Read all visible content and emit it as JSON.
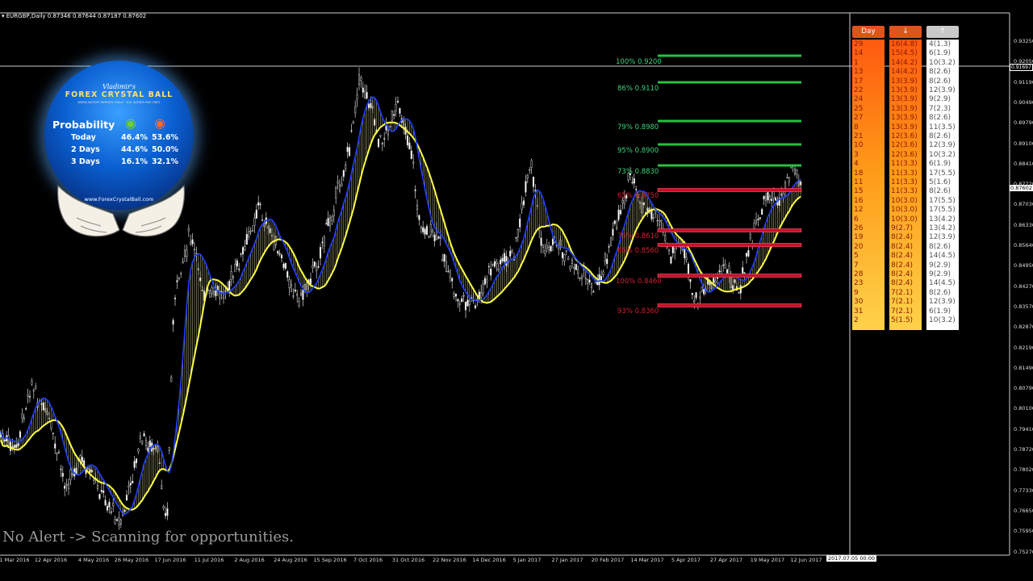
{
  "symbol_line": "EURGBP,Daily  0.87346 0.87644 0.87187 0.87602",
  "alert_text": "No Alert -> Scanning for opportunities.",
  "y_axis": [
    "0.93250",
    "0.92050",
    "0.91190",
    "0.90490",
    "0.89790",
    "0.89100",
    "0.88410",
    "0.87720",
    "0.87030",
    "0.86330",
    "0.85640",
    "0.84950",
    "0.84270",
    "0.83570",
    "0.82870",
    "0.82190",
    "0.81490",
    "0.80790",
    "0.80100",
    "0.79410",
    "0.78720",
    "0.78020",
    "0.77330",
    "0.76650",
    "0.75950",
    "0.75270"
  ],
  "price_tag": "0.87602",
  "cursor_price_tag": "0.91697",
  "x_axis": [
    "1 Mar 2016",
    "12 Apr 2016",
    "4 May 2016",
    "26 May 2016",
    "17 Jun 2016",
    "11 Jul 2016",
    "2 Aug 2016",
    "24 Aug 2016",
    "15 Sep 2016",
    "7 Oct 2016",
    "31 Oct 2016",
    "22 Nov 2016",
    "14 Dec 2016",
    "5 Jan 2017",
    "27 Jan 2017",
    "20 Feb 2017",
    "14 Mar 2017",
    "5 Apr 2017",
    "27 Apr 2017",
    "19 May 2017",
    "12 Jun 2017"
  ],
  "date_tag": "2017.07.05 00:00",
  "levels": [
    {
      "label": "100% 0.9200",
      "color": "green"
    },
    {
      "label": "86% 0.9110",
      "color": "green"
    },
    {
      "label": "79% 0.8980",
      "color": "green"
    },
    {
      "label": "95% 0.8900",
      "color": "green"
    },
    {
      "label": "73% 0.8830",
      "color": "green"
    },
    {
      "label": "65% 0.8750",
      "color": "red"
    },
    {
      "label": "75% 0.8610",
      "color": "red"
    },
    {
      "label": "66% 0.8560",
      "color": "red"
    },
    {
      "label": "100% 0.8460",
      "color": "red"
    },
    {
      "label": "93% 0.8360",
      "color": "red"
    }
  ],
  "logo": {
    "title1": "Vladimir's",
    "title2": "FOREX CRYSTAL BALL",
    "subtitle": "WHEN HISTORY REPEATS ITSELF · YOU GATHER FIVE FIRST",
    "prob_label": "Probability",
    "rows": [
      {
        "label": "Today",
        "bull": "46.4%",
        "bear": "53.6%"
      },
      {
        "label": "2 Days",
        "bull": "44.6%",
        "bear": "50.0%"
      },
      {
        "label": "3 Days",
        "bull": "16.1%",
        "bear": "32.1%"
      }
    ],
    "url": "www.ForexCrystalBall.com"
  },
  "table": {
    "headers": {
      "day": "Day",
      "down": "↓",
      "up": "↑"
    },
    "rows": [
      [
        "29",
        "16(4.8)",
        "4(1.3)"
      ],
      [
        "14",
        "15(4.5)",
        "6(1.9)"
      ],
      [
        "1",
        "14(4.2)",
        "10(3.2)"
      ],
      [
        "13",
        "14(4.2)",
        "8(2.6)"
      ],
      [
        "17",
        "13(3.9)",
        "8(2.6)"
      ],
      [
        "22",
        "13(3.9)",
        "12(3.9)"
      ],
      [
        "24",
        "13(3.9)",
        "9(2.9)"
      ],
      [
        "25",
        "13(3.9)",
        "7(2.3)"
      ],
      [
        "27",
        "13(3.9)",
        "8(2.6)"
      ],
      [
        "8",
        "13(3.9)",
        "11(3.5)"
      ],
      [
        "21",
        "12(3.6)",
        "8(2.6)"
      ],
      [
        "10",
        "12(3.6)",
        "12(3.9)"
      ],
      [
        "3",
        "12(3.6)",
        "10(3.2)"
      ],
      [
        "4",
        "11(3.3)",
        "6(1.9)"
      ],
      [
        "18",
        "11(3.3)",
        "17(5.5)"
      ],
      [
        "11",
        "11(3.3)",
        "5(1.6)"
      ],
      [
        "15",
        "11(3.3)",
        "8(2.6)"
      ],
      [
        "16",
        "10(3.0)",
        "17(5.5)"
      ],
      [
        "12",
        "10(3.0)",
        "17(5.5)"
      ],
      [
        "6",
        "10(3.0)",
        "13(4.2)"
      ],
      [
        "26",
        "9(2.7)",
        "13(4.2)"
      ],
      [
        "19",
        "8(2.4)",
        "12(3.9)"
      ],
      [
        "20",
        "8(2.4)",
        "8(2.6)"
      ],
      [
        "5",
        "8(2.4)",
        "14(4.5)"
      ],
      [
        "7",
        "8(2.4)",
        "9(2.9)"
      ],
      [
        "28",
        "8(2.4)",
        "9(2.9)"
      ],
      [
        "23",
        "8(2.4)",
        "14(4.5)"
      ],
      [
        "9",
        "7(2.1)",
        "8(2.6)"
      ],
      [
        "30",
        "7(2.1)",
        "12(3.9)"
      ],
      [
        "31",
        "7(2.1)",
        "6(1.9)"
      ],
      [
        "2",
        "5(1.5)",
        "10(3.2)"
      ]
    ]
  },
  "colors": {
    "fast_ma": "#2040ff",
    "slow_ma": "#ffff40",
    "candles": "#d8d8d8",
    "ribbon": "#e8e8a0"
  }
}
